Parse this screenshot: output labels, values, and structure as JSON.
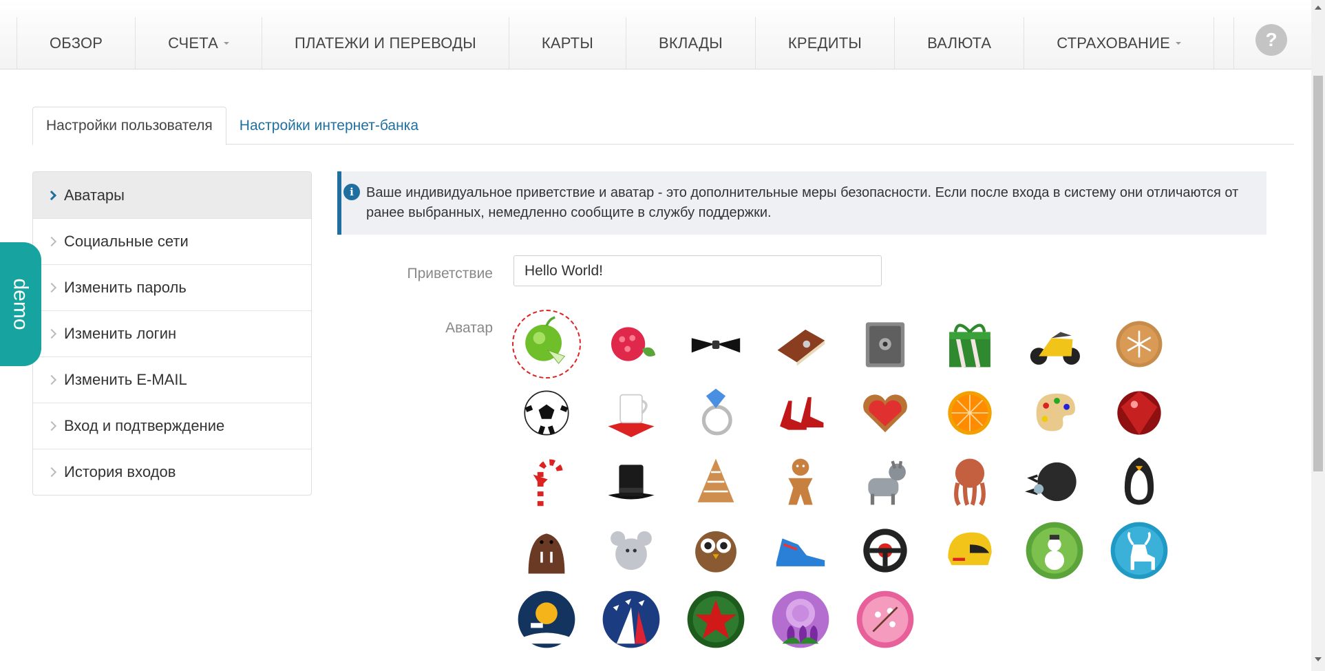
{
  "nav": {
    "items": [
      {
        "label": "ОБЗОР",
        "dropdown": false
      },
      {
        "label": "СЧЕТА",
        "dropdown": true
      },
      {
        "label": "ПЛАТЕЖИ И ПЕРЕВОДЫ",
        "dropdown": false
      },
      {
        "label": "КАРТЫ",
        "dropdown": false
      },
      {
        "label": "ВКЛАДЫ",
        "dropdown": false
      },
      {
        "label": "КРЕДИТЫ",
        "dropdown": false
      },
      {
        "label": "ВАЛЮТА",
        "dropdown": false
      },
      {
        "label": "СТРАХОВАНИЕ",
        "dropdown": true
      }
    ],
    "help_label": "?"
  },
  "tabs": [
    {
      "label": "Настройки пользователя",
      "active": true
    },
    {
      "label": "Настройки интернет-банка",
      "active": false
    }
  ],
  "sidebar": {
    "items": [
      {
        "label": "Аватары",
        "active": true
      },
      {
        "label": "Социальные сети",
        "active": false
      },
      {
        "label": "Изменить пароль",
        "active": false
      },
      {
        "label": "Изменить логин",
        "active": false
      },
      {
        "label": "Изменить E-MAIL",
        "active": false
      },
      {
        "label": "Вход и подтверждение",
        "active": false
      },
      {
        "label": "История входов",
        "active": false
      }
    ]
  },
  "demo_label": "demo",
  "alert": {
    "text": "Ваше индивидуальное приветствие и аватар - это дополнительные меры безопасности. Если после входа в систему они отличаются от ранее выбранных, немедленно сообщите в службу поддержки."
  },
  "form": {
    "greeting_label": "Приветствие",
    "greeting_value": "Hello World!",
    "avatar_label": "Аватар"
  },
  "avatars": [
    {
      "name": "green-apple",
      "selected": true
    },
    {
      "name": "raspberry"
    },
    {
      "name": "bow-tie"
    },
    {
      "name": "book"
    },
    {
      "name": "safe"
    },
    {
      "name": "gift-box"
    },
    {
      "name": "motorcycle"
    },
    {
      "name": "snowflake-cookie"
    },
    {
      "name": "soccer-ball"
    },
    {
      "name": "coffee-cup"
    },
    {
      "name": "diamond-ring"
    },
    {
      "name": "high-heels"
    },
    {
      "name": "heart-cookie"
    },
    {
      "name": "orange-slice"
    },
    {
      "name": "paint-palette"
    },
    {
      "name": "ruby"
    },
    {
      "name": "candy-cane"
    },
    {
      "name": "top-hat"
    },
    {
      "name": "christmas-tree-cookie"
    },
    {
      "name": "gingerbread-man"
    },
    {
      "name": "donkey"
    },
    {
      "name": "octopus"
    },
    {
      "name": "hedgehog"
    },
    {
      "name": "penguin"
    },
    {
      "name": "walrus"
    },
    {
      "name": "chinchilla"
    },
    {
      "name": "owl"
    },
    {
      "name": "sneaker"
    },
    {
      "name": "steering-wheel"
    },
    {
      "name": "racing-helmet"
    },
    {
      "name": "snowman-badge"
    },
    {
      "name": "deer-badge"
    },
    {
      "name": "santa-sleigh-badge"
    },
    {
      "name": "airshow-badge"
    },
    {
      "name": "red-star-badge"
    },
    {
      "name": "tulips-badge"
    },
    {
      "name": "blossom-badge"
    }
  ],
  "colors": {
    "accent": "#1f6fa0",
    "demo": "#17a39f",
    "selected_border": "#dd2222"
  }
}
